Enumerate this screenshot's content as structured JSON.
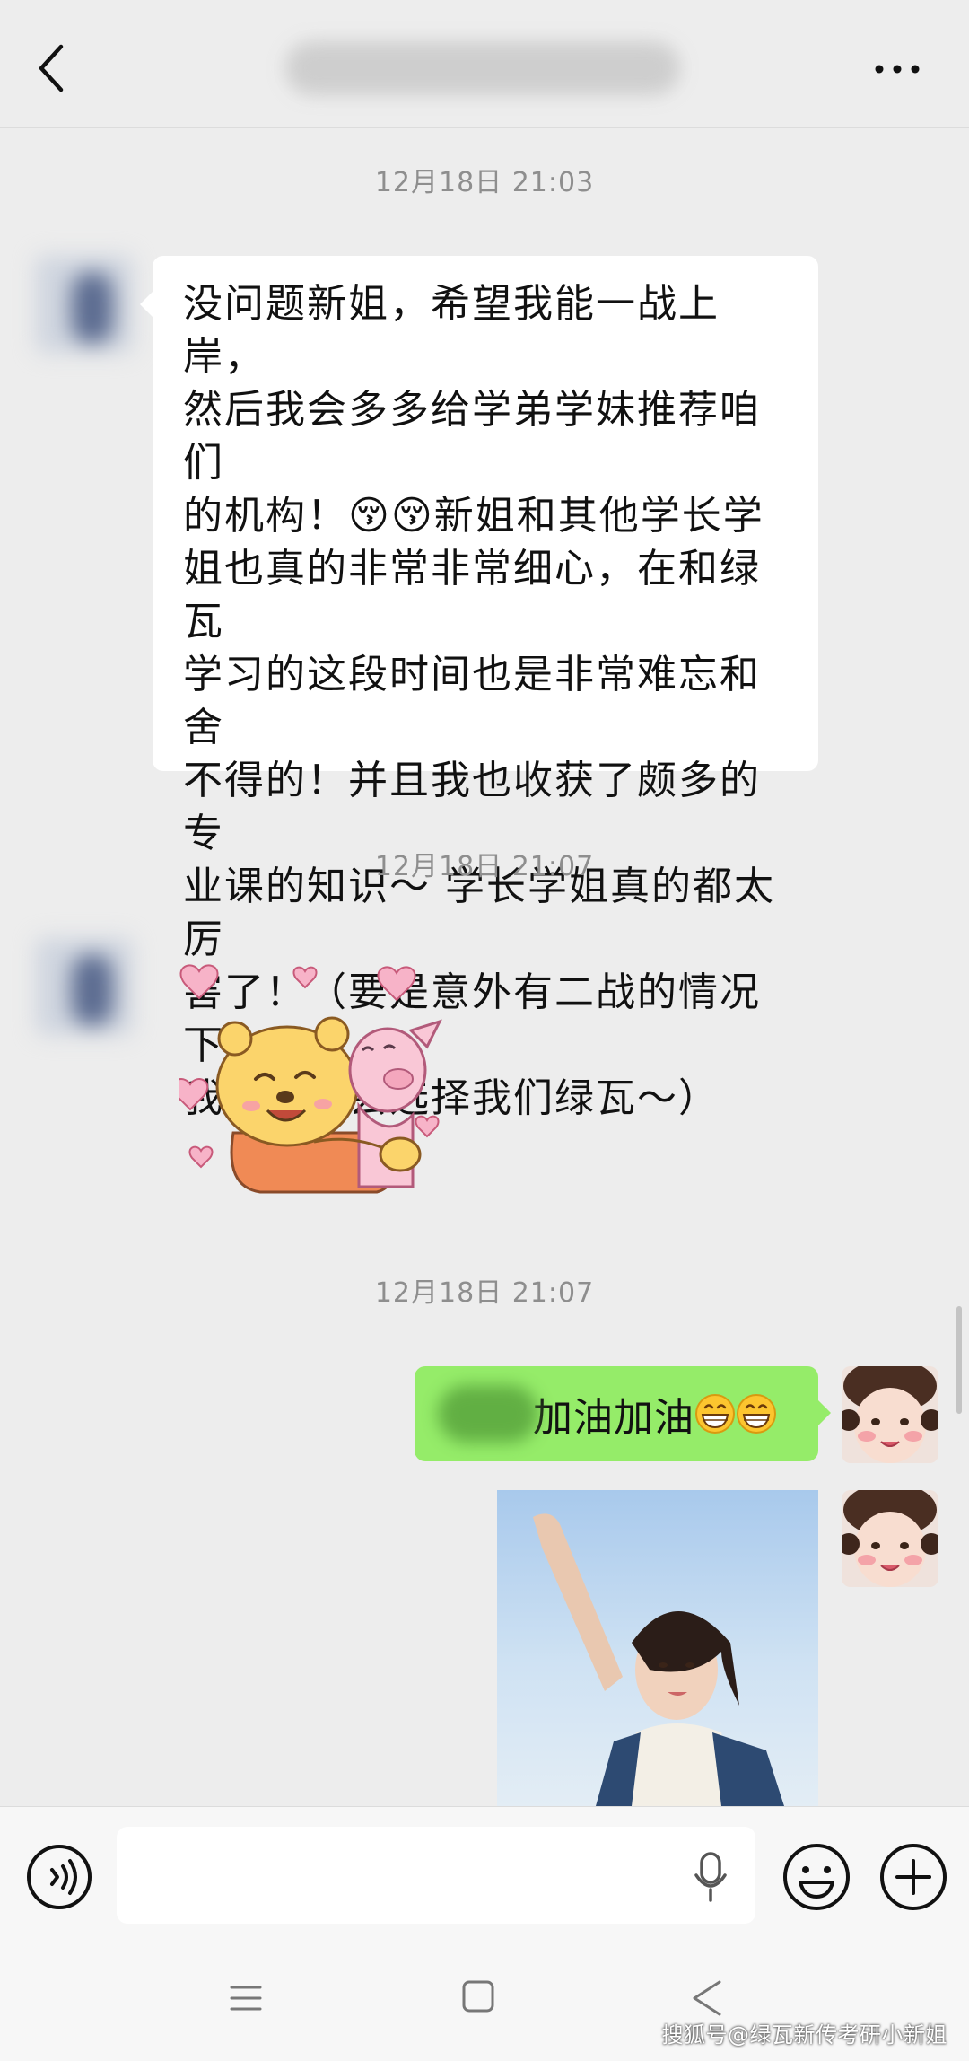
{
  "header": {
    "back_icon": "chevron-left-icon",
    "title": "",
    "more_icon": "more-dots-icon"
  },
  "messages": [
    {
      "timestamp": "12月18日 21:03",
      "sender": "contact",
      "type": "text",
      "text": "没问题新姐，希望我能一战上岸，\n然后我会多多给学弟学妹推荐咱们\n的机构！😚😚新姐和其他学长学\n姐也真的非常非常细心，在和绿瓦\n学习的这段时间也是非常难忘和舍\n不得的！并且我也收获了颇多的专\n业课的知识～ 学长学姐真的都太厉\n害了！（要是意外有二战的情况下\n我也还是会选择我们绿瓦～）"
    },
    {
      "timestamp": "12月18日 21:07",
      "sender": "contact",
      "type": "sticker",
      "sticker_icon": "pooh-piglet-hug-sticker"
    },
    {
      "timestamp": "12月18日 21:07",
      "sender": "me",
      "type": "text",
      "text": "加油加油",
      "emoji_icon": "grinning-face-emoji",
      "emoji_count": 2
    },
    {
      "sender": "me",
      "type": "image",
      "image_icon": "girl-waving-sky-photo"
    }
  ],
  "input_bar": {
    "voice_icon": "voice-mode-icon",
    "input_value": "",
    "mic_icon": "microphone-icon",
    "emoji_icon": "emoji-face-icon",
    "plus_icon": "plus-circle-icon"
  },
  "nav_bar": {
    "menu_icon": "menu-lines-icon",
    "home_icon": "home-square-icon",
    "back_icon": "back-triangle-icon"
  },
  "watermark": "搜狐号@绿瓦新传考研小新姐",
  "colors": {
    "background": "#ededed",
    "bubble_me": "#95ec69",
    "bubble_contact": "#ffffff",
    "timestamp": "#8e8e8e"
  }
}
